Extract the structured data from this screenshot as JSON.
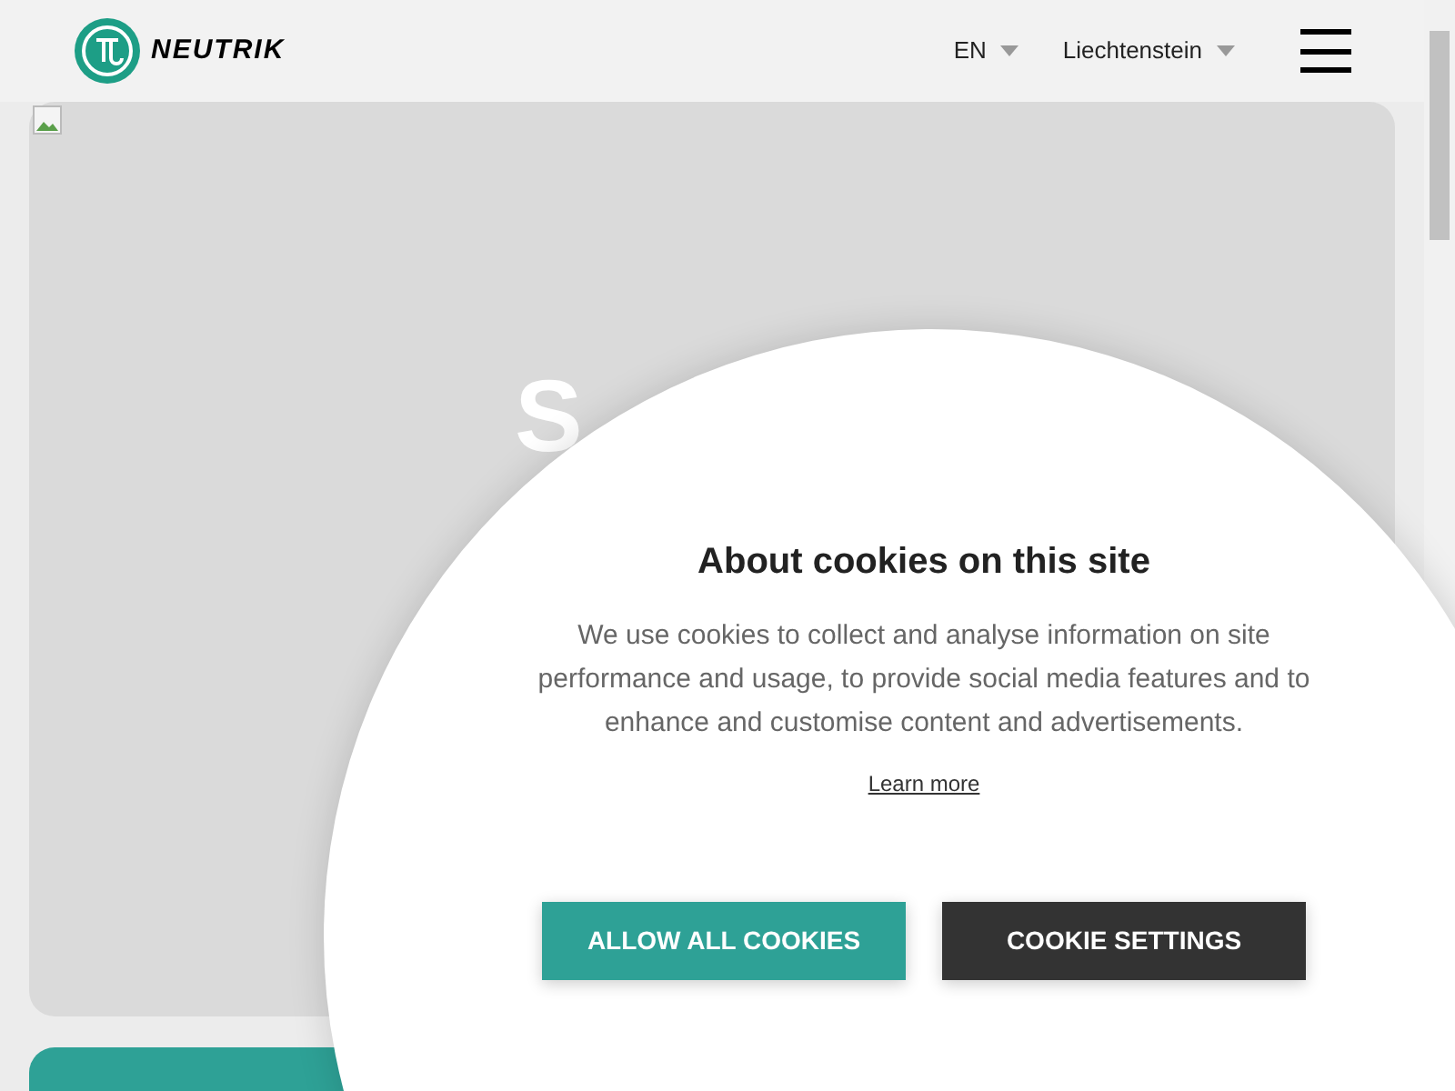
{
  "header": {
    "logo_text": "NEUTRIK",
    "language": "EN",
    "country": "Liechtenstein"
  },
  "hero": {
    "heading": "S"
  },
  "cookie_dialog": {
    "title": "About cookies on this site",
    "body": "We use cookies to collect and analyse information on site performance and usage, to provide social media features and to enhance and customise content and advertisements.",
    "link": "Learn more",
    "buttons": [
      {
        "label": "ALLOW ALL COOKIES",
        "kind": "primary"
      },
      {
        "label": "COOKIE SETTINGS",
        "kind": "dark"
      }
    ]
  }
}
